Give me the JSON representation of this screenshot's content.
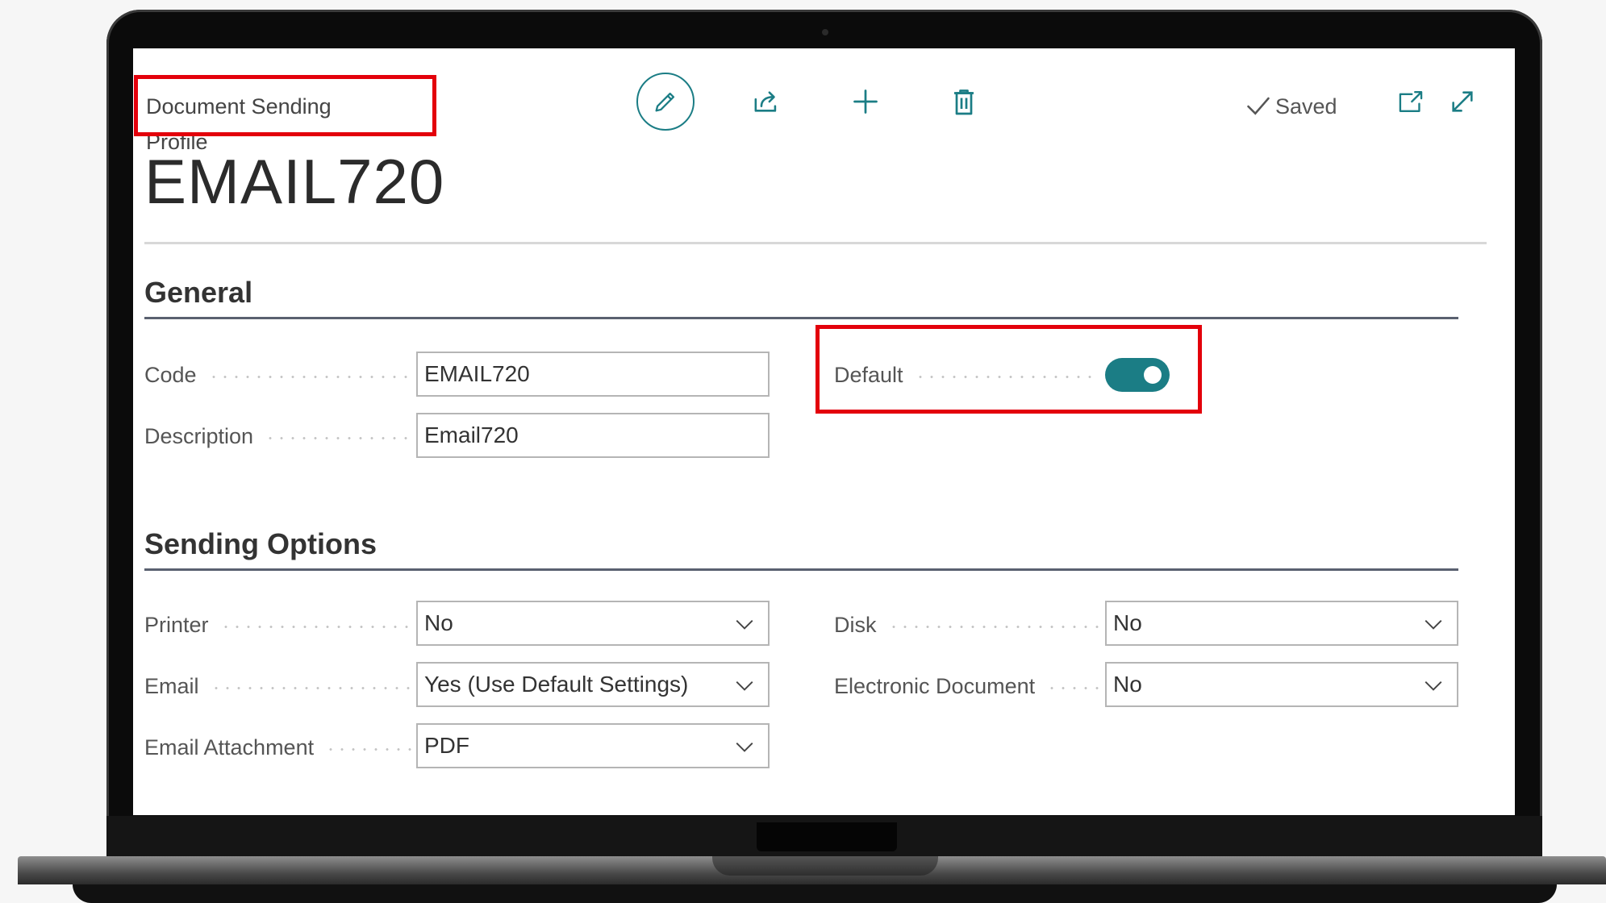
{
  "header": {
    "breadcrumb": "Document Sending Profile",
    "status": "Saved",
    "title": "EMAIL720"
  },
  "toolbar": {
    "icons": [
      "pencil-icon",
      "share-icon",
      "plus-icon",
      "trash-icon",
      "checkmark-icon",
      "open-in-new-window-icon",
      "expand-icon"
    ]
  },
  "general": {
    "title": "General",
    "code": {
      "label": "Code",
      "value": "EMAIL720"
    },
    "description": {
      "label": "Description",
      "value": "Email720"
    },
    "default": {
      "label": "Default",
      "value": true
    }
  },
  "sending": {
    "title": "Sending Options",
    "printer": {
      "label": "Printer",
      "value": "No"
    },
    "email": {
      "label": "Email",
      "value": "Yes (Use Default Settings)"
    },
    "attachment": {
      "label": "Email Attachment",
      "value": "PDF"
    },
    "disk": {
      "label": "Disk",
      "value": "No"
    },
    "electronic": {
      "label": "Electronic Document",
      "value": "No"
    }
  },
  "colors": {
    "accent": "#1b7d85",
    "highlight": "#e3000b"
  }
}
